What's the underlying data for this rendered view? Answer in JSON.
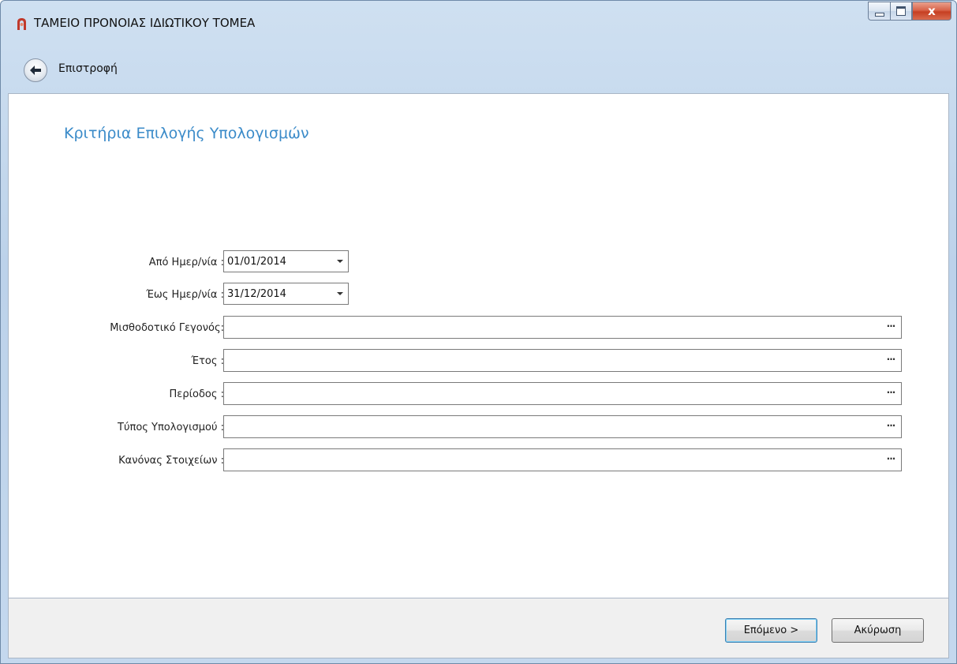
{
  "window": {
    "title": "ΤΑΜΕΙΟ ΠΡΟΝΟΙΑΣ ΙΔΙΩΤΙΚΟΥ ΤΟΜΕΑ",
    "close_glyph": "x"
  },
  "nav": {
    "back_label": "Επιστροφή"
  },
  "page": {
    "title": "Κριτήρια Επιλογής Υπολογισμών"
  },
  "form": {
    "from_date": {
      "label": "Από Ημερ/νία :",
      "value": "01/01/2014"
    },
    "to_date": {
      "label": "Έως Ημερ/νία :",
      "value": "31/12/2014"
    },
    "payroll_event": {
      "label": "Μισθοδοτικό Γεγονός:",
      "value": ""
    },
    "year": {
      "label": "Έτος :",
      "value": ""
    },
    "period": {
      "label": "Περίοδος :",
      "value": ""
    },
    "calc_type": {
      "label": "Τύπος Υπολογισμού :",
      "value": ""
    },
    "data_rule": {
      "label": "Κανόνας Στοιχείων :",
      "value": ""
    },
    "browse_glyph": "···"
  },
  "footer": {
    "next_label": "Επόμενο >",
    "cancel_label": "Ακύρωση"
  },
  "colors": {
    "title_accent": "#3b8bc9",
    "app_icon": "#c0392b",
    "close_button": "#c63f22"
  },
  "icons": {
    "app": "app-logo-icon",
    "back": "back-arrow-icon",
    "dropdown": "chevron-down-icon"
  }
}
